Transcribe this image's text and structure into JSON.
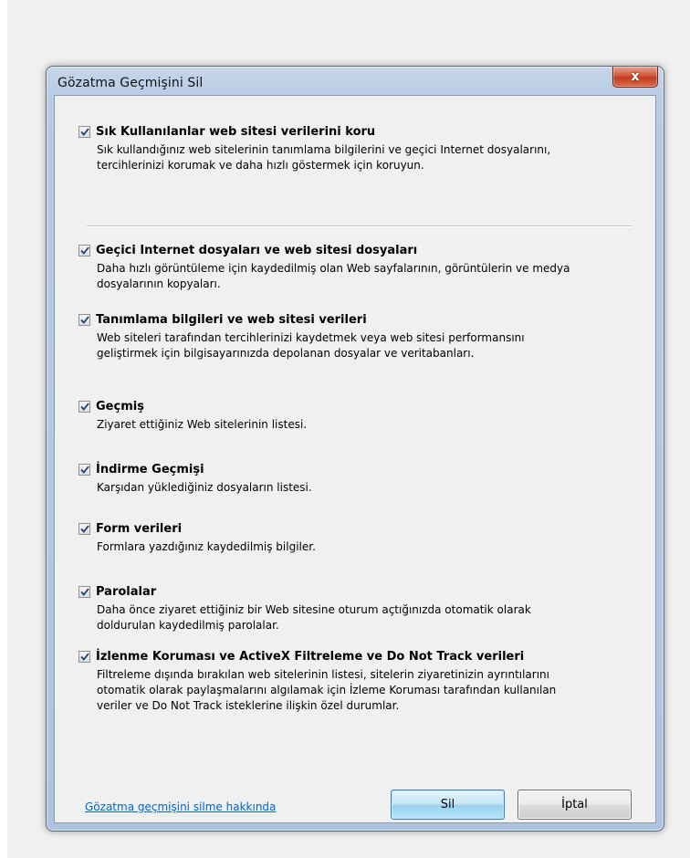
{
  "dialog": {
    "title": "Gözatma Geçmişini Sil",
    "close_label": "x"
  },
  "options": [
    {
      "title": "Sık Kullanılanlar web sitesi verilerini koru",
      "checked": true,
      "desc_lines": [
        "Sık kullandığınız web sitelerinin tanımlama bilgilerini ve geçici Internet dosyalarını,",
        "tercihlerinizi korumak ve daha hızlı göstermek için koruyun."
      ]
    },
    {
      "title": "Geçici Internet dosyaları ve web sitesi dosyaları",
      "checked": true,
      "desc_lines": [
        "Daha hızlı görüntüleme için kaydedilmiş olan Web sayfalarının, görüntülerin ve medya",
        "dosyalarının kopyaları."
      ]
    },
    {
      "title": "Tanımlama bilgileri ve web sitesi verileri",
      "checked": true,
      "desc_lines": [
        "Web siteleri tarafından tercihlerinizi kaydetmek veya web sitesi performansını",
        "geliştirmek için bilgisayarınızda depolanan dosyalar ve veritabanları."
      ]
    },
    {
      "title": "Geçmiş",
      "checked": true,
      "desc_lines": [
        "Ziyaret ettiğiniz Web sitelerinin listesi."
      ]
    },
    {
      "title": "İndirme Geçmişi",
      "checked": true,
      "desc_lines": [
        "Karşıdan yüklediğiniz dosyaların listesi."
      ]
    },
    {
      "title": "Form verileri",
      "checked": true,
      "desc_lines": [
        "Formlara yazdığınız kaydedilmiş bilgiler."
      ]
    },
    {
      "title": "Parolalar",
      "checked": true,
      "desc_lines": [
        "Daha önce ziyaret ettiğiniz bir Web sitesine oturum açtığınızda otomatik olarak",
        "doldurulan kaydedilmiş parolalar."
      ]
    },
    {
      "title": "İzlenme Koruması ve ActiveX Filtreleme ve Do Not Track verileri",
      "checked": true,
      "desc_lines": [
        "Filtreleme dışında bırakılan web sitelerinin listesi, sitelerin ziyaretinizin ayrıntılarını",
        "otomatik olarak paylaşmalarını algılamak için İzleme Koruması tarafından kullanılan",
        "veriler ve Do Not Track isteklerine ilişkin özel durumlar."
      ]
    }
  ],
  "footer": {
    "help_link": "Gözatma geçmişini silme hakkında",
    "delete_label": "Sil",
    "cancel_label": "İptal"
  },
  "colors": {
    "link": "#0066cc",
    "close_button": "#c13d21",
    "default_button_border": "#3c7fb1"
  }
}
